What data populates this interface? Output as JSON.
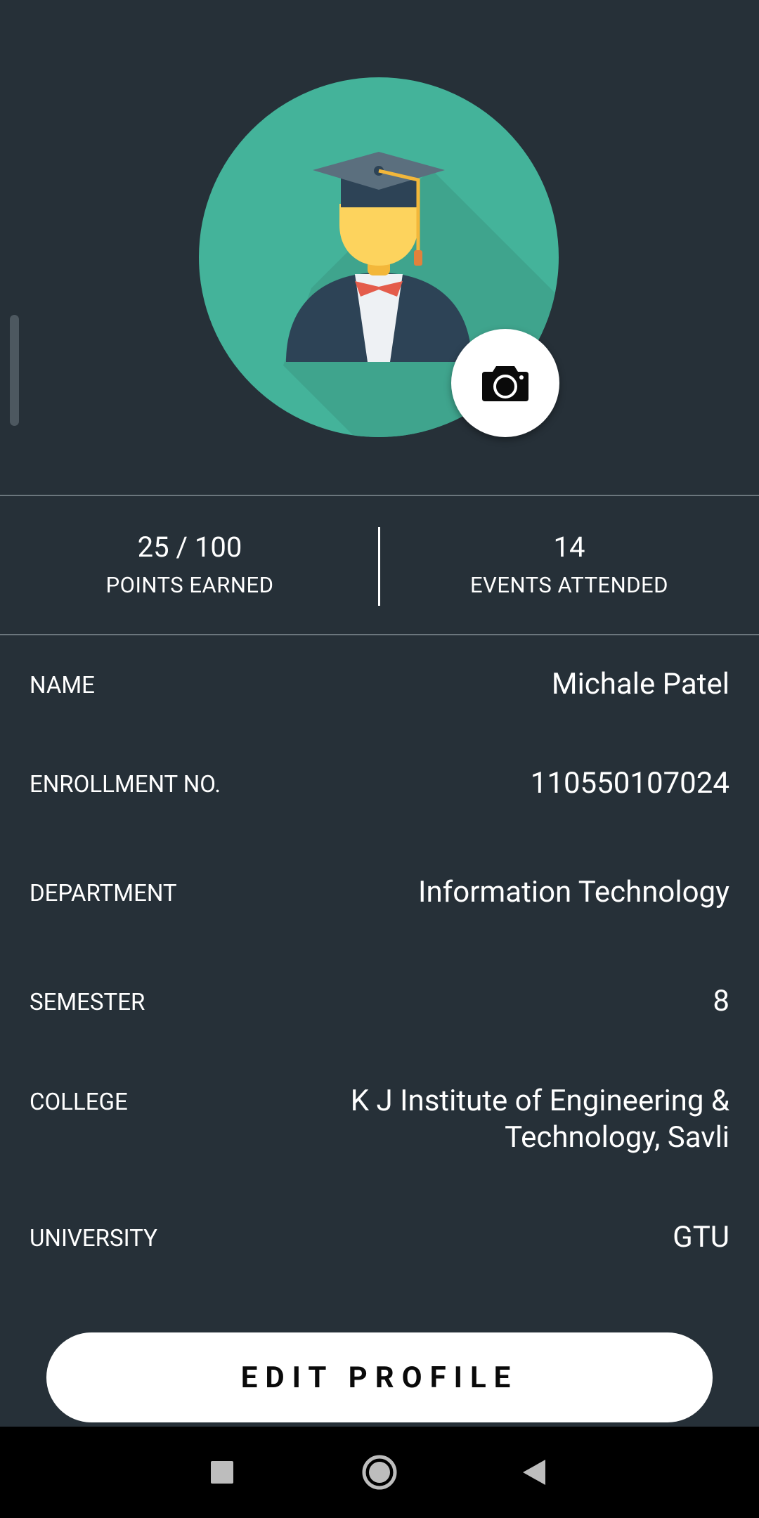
{
  "stats": {
    "points_value": "25 / 100",
    "points_label": "POINTS EARNED",
    "events_value": "14",
    "events_label": "EVENTS ATTENDED"
  },
  "profile": {
    "fields": [
      {
        "label": "NAME",
        "value": "Michale Patel"
      },
      {
        "label": "ENROLLMENT NO.",
        "value": "110550107024"
      },
      {
        "label": "DEPARTMENT",
        "value": "Information Technology"
      },
      {
        "label": "SEMESTER",
        "value": "8"
      },
      {
        "label": "COLLEGE",
        "value": "K J Institute of Engineering & Technology, Savli"
      },
      {
        "label": "UNIVERSITY",
        "value": "GTU"
      }
    ]
  },
  "actions": {
    "edit_profile_label": "EDIT PROFILE"
  },
  "icons": {
    "avatar": "graduate-avatar-icon",
    "camera": "camera-icon",
    "nav_recents": "square-icon",
    "nav_home": "circle-icon",
    "nav_back": "triangle-back-icon"
  },
  "colors": {
    "background": "#263038",
    "avatar_circle": "#44b39a",
    "button": "#ffffff",
    "nav_bar": "#000000"
  }
}
